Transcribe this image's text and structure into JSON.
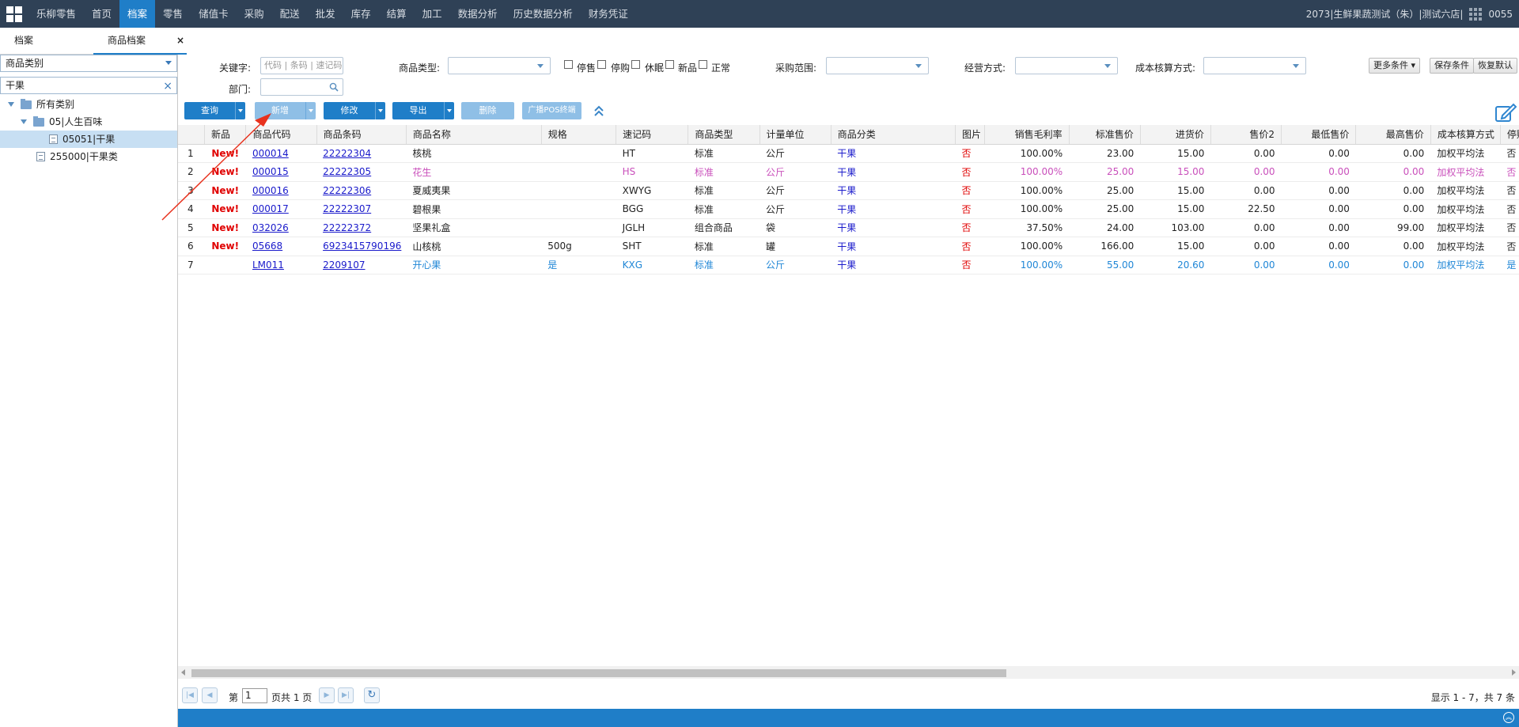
{
  "nav": {
    "items": [
      "乐柳零售",
      "首页",
      "档案",
      "零售",
      "储值卡",
      "采购",
      "配送",
      "批发",
      "库存",
      "结算",
      "加工",
      "数据分析",
      "历史数据分析",
      "财务凭证"
    ],
    "active_index": 2,
    "store": "2073|生鲜果蔬测试（朱）|测试六店|",
    "user": "0055"
  },
  "tabs": {
    "archive": "档案",
    "product": "商品档案",
    "close": "×"
  },
  "sidebar": {
    "category_select": "商品类别",
    "search_value": "干果",
    "tree": [
      {
        "label": "所有类别",
        "level": 0,
        "type": "folder"
      },
      {
        "label": "05|人生百味",
        "level": 1,
        "type": "folder"
      },
      {
        "label": "05051|干果",
        "level": 2,
        "type": "doc",
        "selected": true
      },
      {
        "label": "255000|干果类",
        "level": 1,
        "type": "doc"
      }
    ]
  },
  "filters": {
    "keyword_label": "关键字:",
    "keyword_placeholder": "代码 | 条码 | 速记码 | 名称",
    "type_label": "商品类型:",
    "checkboxes": [
      "停售",
      "停购",
      "休眠",
      "新品",
      "正常"
    ],
    "purchase_label": "采购范围:",
    "business_label": "经营方式:",
    "cost_label": "成本核算方式:",
    "dept_label": "部门:",
    "more": "更多条件 ▾",
    "save": "保存条件",
    "reset": "恢复默认"
  },
  "toolbar": {
    "query": "查询",
    "add": "新增",
    "edit": "修改",
    "export": "导出",
    "delete": "删除",
    "broadcast": "广播POS终端"
  },
  "table": {
    "headers": [
      "",
      "新品",
      "商品代码",
      "商品条码",
      "商品名称",
      "规格",
      "速记码",
      "商品类型",
      "计量单位",
      "商品分类",
      "图片",
      "销售毛利率",
      "标准售价",
      "进货价",
      "售价2",
      "最低售价",
      "最高售价",
      "成本核算方式",
      "停购标识"
    ],
    "rows": [
      {
        "n": "1",
        "new": "New!",
        "code": "000014",
        "barcode": "22222304",
        "name": "核桃",
        "spec": "",
        "short": "HT",
        "type": "标准",
        "unit": "公斤",
        "cat": "干果",
        "pic": "否",
        "margin": "100.00%",
        "std": "23.00",
        "cost": "15.00",
        "p2": "0.00",
        "min": "0.00",
        "max": "0.00",
        "method": "加权平均法",
        "stop": "否",
        "style": ""
      },
      {
        "n": "2",
        "new": "New!",
        "code": "000015",
        "barcode": "22222305",
        "name": "花生",
        "spec": "",
        "short": "HS",
        "type": "标准",
        "unit": "公斤",
        "cat": "干果",
        "pic": "否",
        "margin": "100.00%",
        "std": "25.00",
        "cost": "15.00",
        "p2": "0.00",
        "min": "0.00",
        "max": "0.00",
        "method": "加权平均法",
        "stop": "否",
        "style": "pink"
      },
      {
        "n": "3",
        "new": "New!",
        "code": "000016",
        "barcode": "22222306",
        "name": "夏威夷果",
        "spec": "",
        "short": "XWYG",
        "type": "标准",
        "unit": "公斤",
        "cat": "干果",
        "pic": "否",
        "margin": "100.00%",
        "std": "25.00",
        "cost": "15.00",
        "p2": "0.00",
        "min": "0.00",
        "max": "0.00",
        "method": "加权平均法",
        "stop": "否",
        "style": ""
      },
      {
        "n": "4",
        "new": "New!",
        "code": "000017",
        "barcode": "22222307",
        "name": "碧根果",
        "spec": "",
        "short": "BGG",
        "type": "标准",
        "unit": "公斤",
        "cat": "干果",
        "pic": "否",
        "margin": "100.00%",
        "std": "25.00",
        "cost": "15.00",
        "p2": "22.50",
        "min": "0.00",
        "max": "0.00",
        "method": "加权平均法",
        "stop": "否",
        "style": ""
      },
      {
        "n": "5",
        "new": "New!",
        "code": "032026",
        "barcode": "22222372",
        "name": "坚果礼盒",
        "spec": "",
        "short": "JGLH",
        "type": "组合商品",
        "unit": "袋",
        "cat": "干果",
        "pic": "否",
        "margin": "37.50%",
        "std": "24.00",
        "cost": "103.00",
        "p2": "0.00",
        "min": "0.00",
        "max": "99.00",
        "method": "加权平均法",
        "stop": "否",
        "style": ""
      },
      {
        "n": "6",
        "new": "New!",
        "code": "05668",
        "barcode": "6923415790196",
        "name": "山核桃",
        "spec": "500g",
        "short": "SHT",
        "type": "标准",
        "unit": "罐",
        "cat": "干果",
        "pic": "否",
        "margin": "100.00%",
        "std": "166.00",
        "cost": "15.00",
        "p2": "0.00",
        "min": "0.00",
        "max": "0.00",
        "method": "加权平均法",
        "stop": "否",
        "style": ""
      },
      {
        "n": "7",
        "new": "",
        "code": "LM011",
        "barcode": "2209107",
        "name": "开心果",
        "spec": "是",
        "short": "KXG",
        "type": "标准",
        "unit": "公斤",
        "cat": "干果",
        "pic": "否",
        "margin": "100.00%",
        "std": "55.00",
        "cost": "20.60",
        "p2": "0.00",
        "min": "0.00",
        "max": "0.00",
        "method": "加权平均法",
        "stop": "是",
        "style": "blue"
      }
    ]
  },
  "pager": {
    "first": "|◀",
    "prev": "◀",
    "page_label": "第",
    "page_value": "1",
    "total_label": "页共 1 页",
    "next": "▶",
    "last": "▶|",
    "refresh": "↻",
    "summary": "显示 1 - 7，共 7 条"
  },
  "colors": {
    "nav_bg": "#2f4156",
    "accent": "#1f7ec8",
    "red": "#e00000",
    "link": "#1a1acb"
  }
}
